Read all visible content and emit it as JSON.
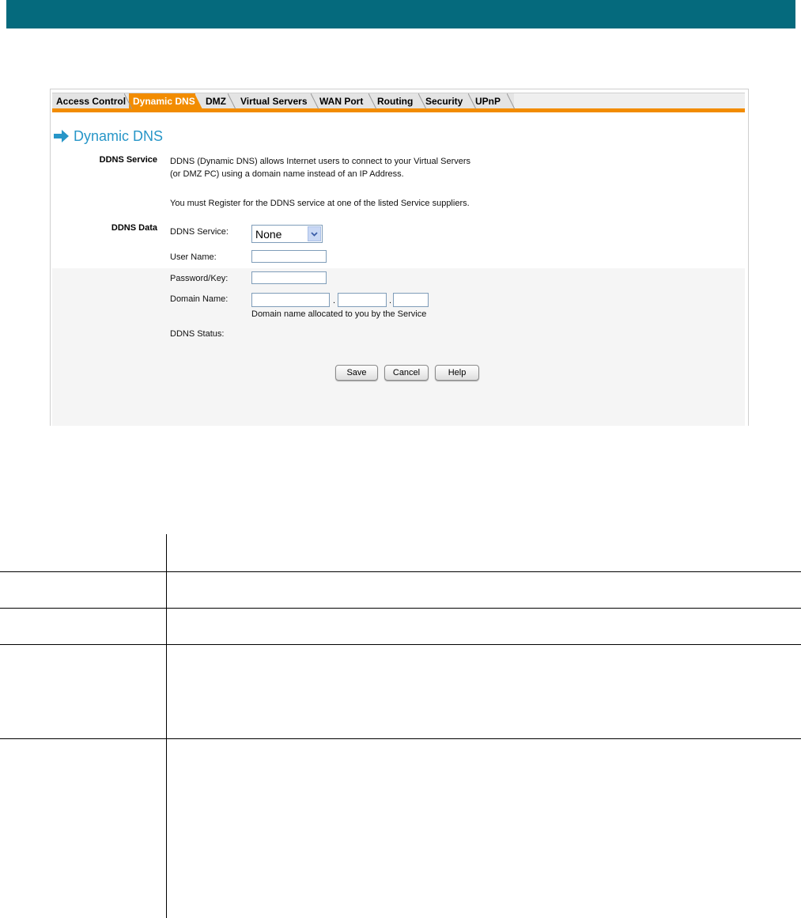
{
  "tabs": [
    {
      "label": "Access Control",
      "active": false
    },
    {
      "label": "Dynamic DNS",
      "active": true
    },
    {
      "label": "DMZ",
      "active": false
    },
    {
      "label": "Virtual Servers",
      "active": false
    },
    {
      "label": "WAN Port",
      "active": false
    },
    {
      "label": "Routing",
      "active": false
    },
    {
      "label": "Security",
      "active": false
    },
    {
      "label": "UPnP",
      "active": false
    }
  ],
  "page": {
    "title": "Dynamic DNS",
    "title_icon": "right-arrow-icon",
    "accent_color": "#f28c00",
    "title_color": "#2796c8",
    "header_color": "#056a7d"
  },
  "ddns_service": {
    "label": "DDNS Service",
    "line1": "DDNS (Dynamic DNS) allows Internet users to connect to your Virtual Servers",
    "line2": "(or DMZ PC) using a domain name instead of an IP Address.",
    "line3": "You must Register for the DDNS service at one of the listed Service suppliers."
  },
  "ddns_data": {
    "label": "DDNS Data",
    "service_label": "DDNS Service:",
    "service_value": "None",
    "username_label": "User Name:",
    "username_value": "",
    "password_label": "Password/Key:",
    "password_value": "",
    "domain_label": "Domain Name:",
    "domain_part1": "",
    "domain_part2": "",
    "domain_part3": "",
    "domain_sep": ".",
    "domain_hint": "Domain name allocated to you by the Service",
    "status_label": "DDNS Status:",
    "status_value": ""
  },
  "buttons": {
    "save": "Save",
    "cancel": "Cancel",
    "help": "Help"
  }
}
